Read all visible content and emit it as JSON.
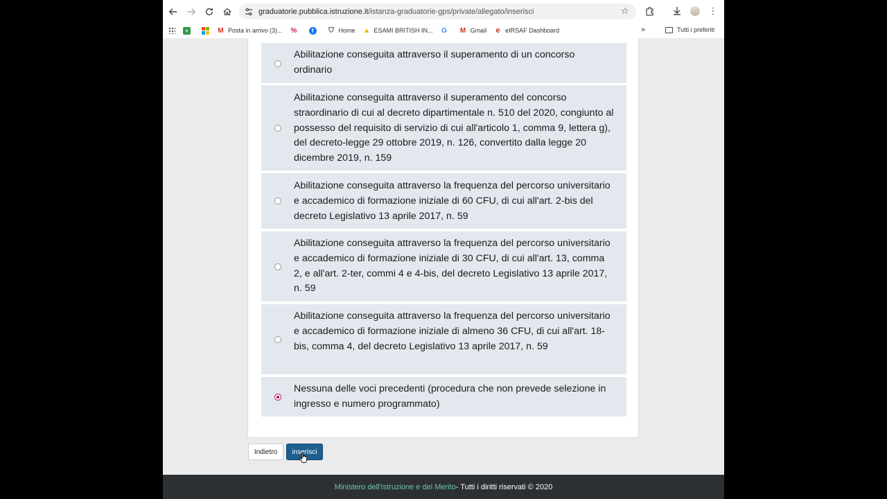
{
  "browser": {
    "url_host": "graduatorie.pubblica.istruzione.it",
    "url_path": "/istanza-graduatorie-gps/private/allegato/inserisci"
  },
  "bookmarks": [
    {
      "label": "",
      "icon": "apps-grid-icon"
    },
    {
      "label": "",
      "icon": "green-plus-icon",
      "color": "#2e9b47"
    },
    {
      "label": "",
      "icon": "microsoft-icon"
    },
    {
      "label": "Posta in arrivo (3)...",
      "icon": "gmail-icon",
      "color": "#d93025"
    },
    {
      "label": "",
      "icon": "dazn-icon",
      "color": "#c2185b"
    },
    {
      "label": "",
      "icon": "facebook-icon",
      "color": "#1877f2"
    },
    {
      "label": "Home",
      "icon": "home-shield-icon"
    },
    {
      "label": "ESAMI BRITISH IN...",
      "icon": "drive-icon",
      "color": "#f4b400"
    },
    {
      "label": "",
      "icon": "google-icon",
      "color": "#4285f4"
    },
    {
      "label": "Gmail",
      "icon": "gmail-icon",
      "color": "#d93025"
    },
    {
      "label": "eIRSAF Dashboard",
      "icon": "e-logo-icon",
      "color": "#d32f2f"
    }
  ],
  "bookmarks_folder": "Tutti i preferiti",
  "options": [
    {
      "text": "Abilitazione conseguita attraverso il superamento di un concorso ordinario",
      "selected": false
    },
    {
      "text": "Abilitazione conseguita attraverso il superamento del concorso straordinario di cui al decreto dipartimentale n. 510 del 2020, congiunto al possesso del requisito di servizio di cui all'articolo 1, comma 9, lettera g), del decreto-legge 29 ottobre 2019, n. 126, convertito dalla legge 20 dicembre 2019, n. 159",
      "selected": false
    },
    {
      "text": "Abilitazione conseguita attraverso la frequenza del percorso universitario e accademico di formazione iniziale di 60 CFU, di cui all'art. 2-bis del decreto Legislativo 13 aprile 2017, n. 59",
      "selected": false
    },
    {
      "text": "Abilitazione conseguita attraverso la frequenza del percorso universitario e accademico di formazione iniziale di 30 CFU, di cui all'art. 13, comma 2, e all'art. 2-ter, commi 4 e 4-bis, del decreto Legislativo 13 aprile 2017, n. 59",
      "selected": false
    },
    {
      "text": "Abilitazione conseguita attraverso la frequenza del percorso universitario e accademico di formazione iniziale di almeno 36 CFU, di cui all'art. 18-bis, comma 4, del decreto Legislativo 13 aprile 2017, n. 59",
      "selected": false
    },
    {
      "text": "Nessuna delle voci precedenti (procedura che non prevede selezione in ingresso e numero programmato)",
      "selected": true
    }
  ],
  "buttons": {
    "back_label": "Indietro",
    "insert_label": "inserisci"
  },
  "footer": {
    "link": "Ministero dell'Istruzione e del Merito",
    "rest": " - Tutti i diritti riservati © 2020"
  },
  "colors": {
    "accent": "#1d5f8f",
    "radio_selected": "#b10a5e",
    "option_bg": "#e2e8ee",
    "footer_link": "#6fc3a8"
  }
}
